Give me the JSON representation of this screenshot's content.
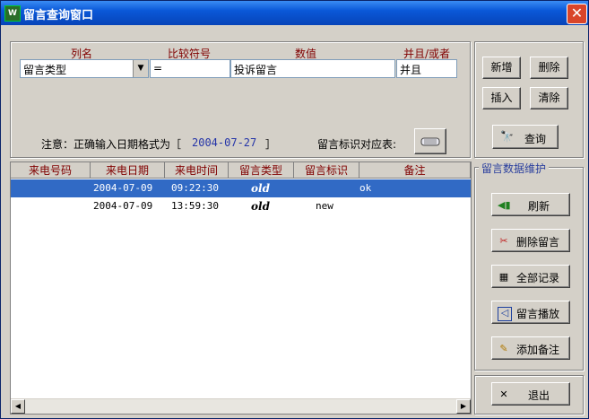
{
  "window": {
    "title": "留言查询窗口",
    "icon": "app-icon",
    "close_symbol": "✕"
  },
  "query": {
    "headers": [
      "列名",
      "比较符号",
      "数值",
      "并且/或者"
    ],
    "column_value": "留言类型",
    "operator_value": "=",
    "value_value": "投诉留言",
    "logic_value": "并且",
    "note_label": "注意：正确输入日期格式为［",
    "note_date": "2004-07-27",
    "note_end": "］",
    "mapping_label": "留言标识对应表:"
  },
  "top_buttons": {
    "new": "新增",
    "delete": "删除",
    "insert": "插入",
    "clear": "清除",
    "search": "查询"
  },
  "table": {
    "columns": [
      "来电号码",
      "来电日期",
      "来电时间",
      "留言类型",
      "留言标识",
      "备注"
    ],
    "rows": [
      {
        "phone": "",
        "date": "2004-07-09",
        "time": "09:22:30",
        "type": "old",
        "flag": "",
        "remark": "ok"
      },
      {
        "phone": "",
        "date": "2004-07-09",
        "time": "13:59:30",
        "type": "old",
        "flag": "new",
        "remark": ""
      }
    ]
  },
  "maintenance": {
    "title": "留言数据维护",
    "buttons": {
      "refresh": "刷新",
      "delete_msg": "删除留言",
      "all_records": "全部记录",
      "play": "留言播放",
      "add_note": "添加备注"
    }
  },
  "exit_label": "退出",
  "colors": {
    "selected_row": "#316ac5",
    "header_text": "#800000",
    "group_title": "#2a3f9e"
  }
}
